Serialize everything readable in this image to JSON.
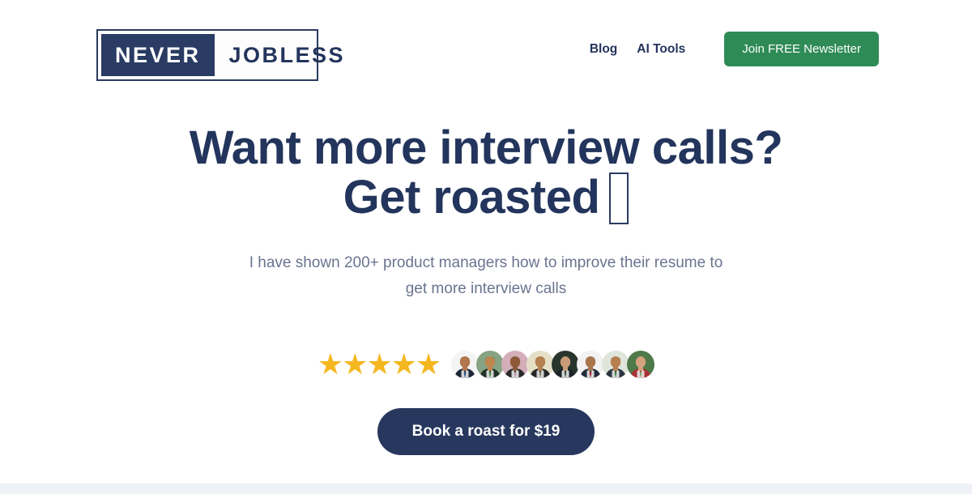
{
  "header": {
    "logo": {
      "word1": "NEVER",
      "word2": "JOBLESS"
    },
    "nav": [
      {
        "label": "Blog",
        "name": "nav-link-blog"
      },
      {
        "label": "AI Tools",
        "name": "nav-link-ai-tools"
      }
    ],
    "cta": {
      "label": "Join FREE Newsletter",
      "color": "#2f8b56"
    }
  },
  "hero": {
    "headline_line1": "Want more interview calls?",
    "headline_line2": "Get roasted",
    "headline_emoji": "missing-glyph-box",
    "subhead_line1": "I have shown 200+ product managers how to improve their",
    "subhead_line2": "resume to get more interview calls",
    "headline_color": "#23355c",
    "subhead_color": "#6b7490"
  },
  "social_proof": {
    "rating_stars": 5,
    "star_glyph": "★",
    "star_color": "#f5b720",
    "avatars": [
      {
        "name": "avatar-1",
        "bg": "#f4f4f4",
        "skin": "#b2754d",
        "hair": "#1d1a18",
        "cloth": "#1d2739",
        "accent": "#2b4f8e"
      },
      {
        "name": "avatar-2",
        "bg": "#86a483",
        "skin": "#c08650",
        "hair": "#231a14",
        "cloth": "#24312a",
        "accent": "#3d8b3d"
      },
      {
        "name": "avatar-3",
        "bg": "#d3aeb9",
        "skin": "#8d5a38",
        "hair": "#191514",
        "cloth": "#2a2a2a",
        "accent": "#b98b9c"
      },
      {
        "name": "avatar-4",
        "bg": "#e6dfc8",
        "skin": "#b5804f",
        "hair": "#1a1614",
        "cloth": "#262626",
        "accent": "#8a8064"
      },
      {
        "name": "avatar-5",
        "bg": "#27352c",
        "skin": "#c99b77",
        "hair": "#12100f",
        "cloth": "#1b232a",
        "accent": "#3e5a45"
      },
      {
        "name": "avatar-6",
        "bg": "#f2f2f2",
        "skin": "#a9764b",
        "hair": "#1b1613",
        "cloth": "#232a3a",
        "accent": "#b5252c"
      },
      {
        "name": "avatar-7",
        "bg": "#dfe5da",
        "skin": "#b77f4f",
        "hair": "#2b231c",
        "cloth": "#2c3540",
        "accent": "#3d8b3d"
      },
      {
        "name": "avatar-8",
        "bg": "#4e7a4a",
        "skin": "#d5a37d",
        "hair": "#3a2419",
        "cloth": "#a83236",
        "accent": "#7ba86f"
      }
    ]
  },
  "cta": {
    "label": "Book a roast for $19",
    "color": "#27375e"
  },
  "page": {
    "background": "#ffffff",
    "bottom_band_color": "#eef1f6"
  }
}
